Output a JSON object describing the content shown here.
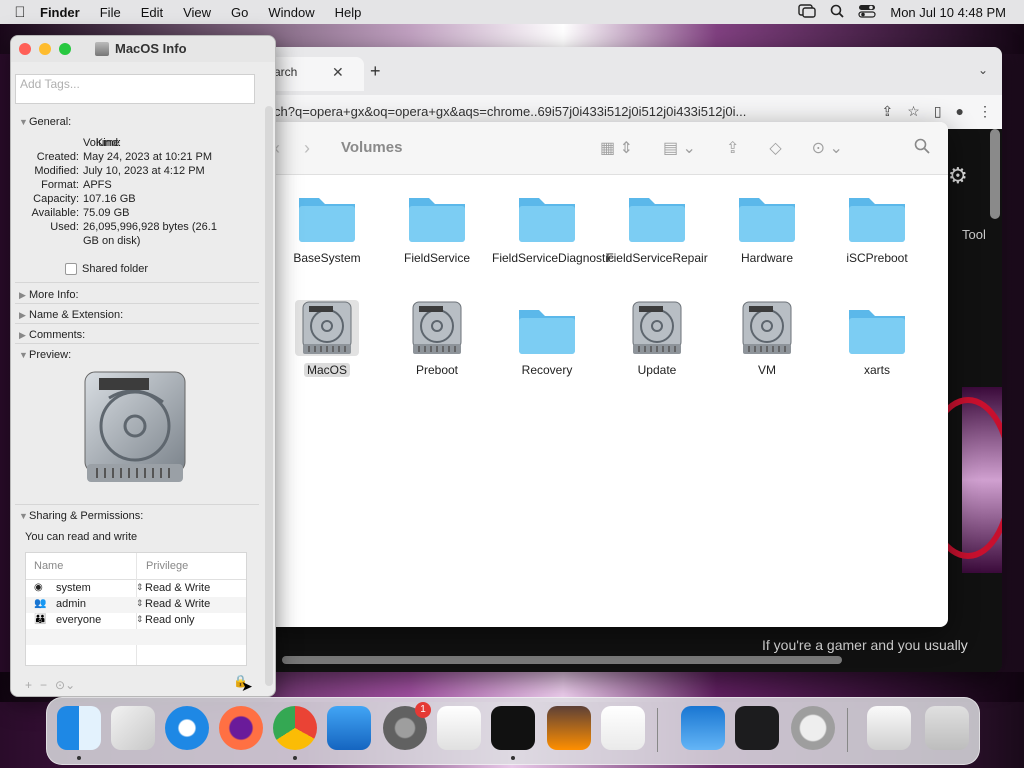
{
  "menubar": {
    "app": "Finder",
    "items": [
      "File",
      "Edit",
      "View",
      "Go",
      "Window",
      "Help"
    ],
    "clock": "Mon Jul 10  4:48 PM"
  },
  "browser": {
    "tab_label": "arch",
    "url": "ch?q=opera+gx&oq=opera+gx&aqs=chrome..69i57j0i433i512j0i512j0i433i512j0i...",
    "tools_label": "Tool",
    "promo_text": "If you're a gamer and you usually"
  },
  "finder": {
    "title": "Volumes",
    "items": [
      {
        "label": "BaseSystem",
        "kind": "folder"
      },
      {
        "label": "FieldService",
        "kind": "folder"
      },
      {
        "label": "FieldServiceDiagnostic",
        "kind": "folder"
      },
      {
        "label": "FieldServiceRepair",
        "kind": "folder"
      },
      {
        "label": "Hardware",
        "kind": "folder"
      },
      {
        "label": "iSCPreboot",
        "kind": "folder"
      },
      {
        "label": "MacOS",
        "kind": "disk"
      },
      {
        "label": "Preboot",
        "kind": "disk"
      },
      {
        "label": "Recovery",
        "kind": "folder"
      },
      {
        "label": "Update",
        "kind": "disk"
      },
      {
        "label": "VM",
        "kind": "disk"
      },
      {
        "label": "xarts",
        "kind": "folder"
      }
    ]
  },
  "info": {
    "title": "MacOS Info",
    "tags_placeholder": "Add Tags...",
    "general_label": "General:",
    "kind_k": "Kind:",
    "kind_v": "Volume",
    "created_k": "Created:",
    "created_v": "May 24, 2023 at 10:21 PM",
    "modified_k": "Modified:",
    "modified_v": "July 10, 2023 at 4:12 PM",
    "format_k": "Format:",
    "format_v": "APFS",
    "capacity_k": "Capacity:",
    "capacity_v": "107.16 GB",
    "available_k": "Available:",
    "available_v": "75.09 GB",
    "used_k": "Used:",
    "used_v1": "26,095,996,928 bytes (26.1",
    "used_v2": "GB on disk)",
    "shared_folder": "Shared folder",
    "more_info": "More Info:",
    "name_ext": "Name & Extension:",
    "comments": "Comments:",
    "preview": "Preview:",
    "sharing": "Sharing & Permissions:",
    "read_write_note": "You can read and write",
    "perm_name_hdr": "Name",
    "perm_priv_hdr": "Privilege",
    "perms": [
      {
        "name": "system",
        "priv": "Read & Write"
      },
      {
        "name": "admin",
        "priv": "Read & Write"
      },
      {
        "name": "everyone",
        "priv": "Read only"
      }
    ]
  },
  "dock": {
    "settings_badge": "1",
    "apps": [
      "finder-icon",
      "launchpad-icon",
      "safari-icon",
      "firefox-icon",
      "chrome-icon",
      "app-store-icon",
      "system-settings-icon",
      "textedit-icon",
      "terminal-icon",
      "garageband-icon",
      "vscode-icon",
      "weather-icon",
      "stocks-icon",
      "disk-utility-icon",
      "screenshot-window-icon",
      "trash-icon"
    ]
  }
}
